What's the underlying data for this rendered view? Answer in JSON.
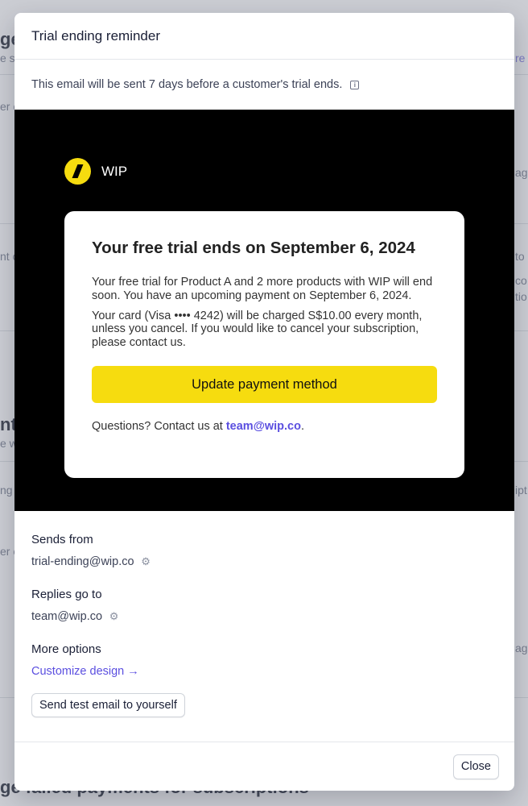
{
  "background": {
    "left_fragments": [
      "ge",
      "e s",
      "er c",
      "nt c",
      "nt",
      "e w",
      "ng",
      "er e"
    ],
    "right_fragments": [
      "re",
      "ag",
      "to",
      "co",
      "tio",
      "ipt",
      "ag"
    ],
    "bottom_heading": "ge failed payments for subscriptions"
  },
  "modal": {
    "title": "Trial ending reminder",
    "intro": "This email will be sent 7 days before a customer's trial ends.",
    "info_icon": "info-icon"
  },
  "email": {
    "brand_name": "WIP",
    "brand_color": "#F6DC0F",
    "heading": "Your free trial ends on September 6, 2024",
    "paragraph1": "Your free trial for Product A and 2 more products with WIP will end soon. You have an upcoming payment on September 6, 2024.",
    "paragraph2": "Your card (Visa •••• 4242) will be charged S$10.00 every month, unless you cancel. If you would like to cancel your subscription, please contact us.",
    "cta_label": "Update payment method",
    "questions_prefix": "Questions? Contact us at ",
    "questions_email": "team@wip.co",
    "questions_suffix": "."
  },
  "settings": {
    "sends_from_label": "Sends from",
    "sends_from_value": "trial-ending@wip.co",
    "replies_label": "Replies go to",
    "replies_value": "team@wip.co",
    "more_options_label": "More options",
    "customize_link": "Customize design →",
    "test_button": "Send test email to yourself"
  },
  "footer": {
    "close_label": "Close"
  },
  "colors": {
    "accent": "#5B4FE0",
    "preview_bg": "#000000"
  }
}
